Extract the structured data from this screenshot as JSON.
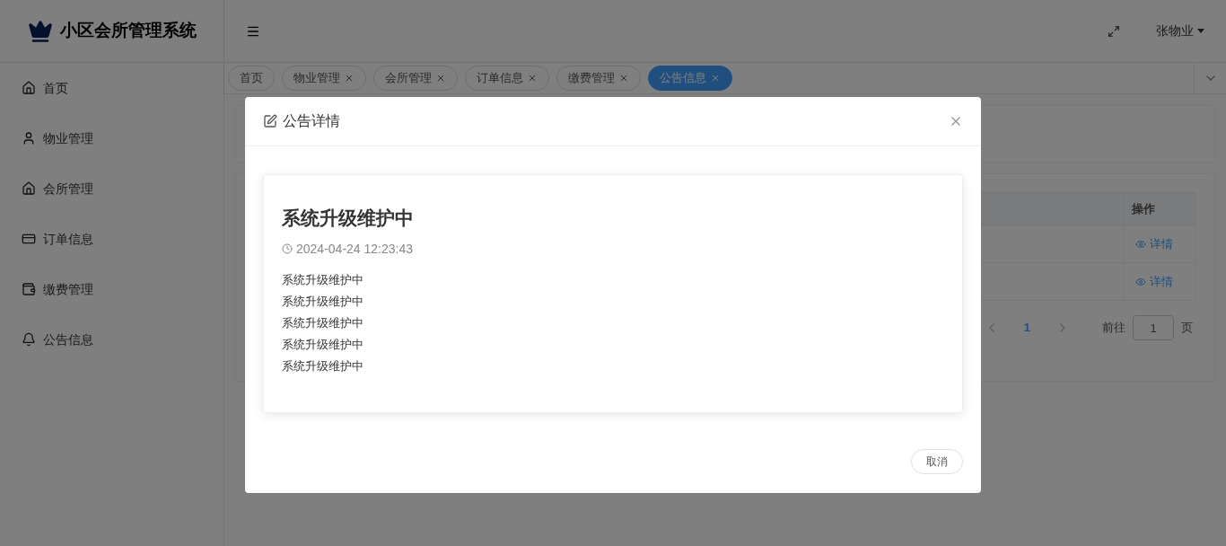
{
  "header": {
    "logo_title": "小区会所管理系统",
    "user": "张物业"
  },
  "sidebar": {
    "items": [
      {
        "label": "首页"
      },
      {
        "label": "物业管理"
      },
      {
        "label": "会所管理"
      },
      {
        "label": "订单信息"
      },
      {
        "label": "缴费管理"
      },
      {
        "label": "公告信息"
      }
    ]
  },
  "tabs": [
    {
      "label": "首页",
      "closable": false,
      "selected": false
    },
    {
      "label": "物业管理",
      "closable": true,
      "selected": false
    },
    {
      "label": "会所管理",
      "closable": true,
      "selected": false
    },
    {
      "label": "订单信息",
      "closable": true,
      "selected": false
    },
    {
      "label": "缴费管理",
      "closable": true,
      "selected": false
    },
    {
      "label": "公告信息",
      "closable": true,
      "selected": true
    }
  ],
  "table": {
    "columns": [
      "操作"
    ],
    "rows": [
      {
        "action": "详情"
      },
      {
        "action": "详情"
      }
    ]
  },
  "pagination": {
    "pages": [
      {
        "label": "1",
        "selected": true
      }
    ],
    "goto_label": "前往",
    "goto_value": "1",
    "page_suffix": "页"
  },
  "dialog": {
    "title": "公告详情",
    "notice": {
      "title": "系统升级维护中",
      "time": "2024-04-24 12:23:43",
      "lines": [
        "系统升级维护中",
        "系统升级维护中",
        "系统升级维护中",
        "系统升级维护中",
        "系统升级维护中"
      ]
    },
    "cancel": "取消"
  }
}
